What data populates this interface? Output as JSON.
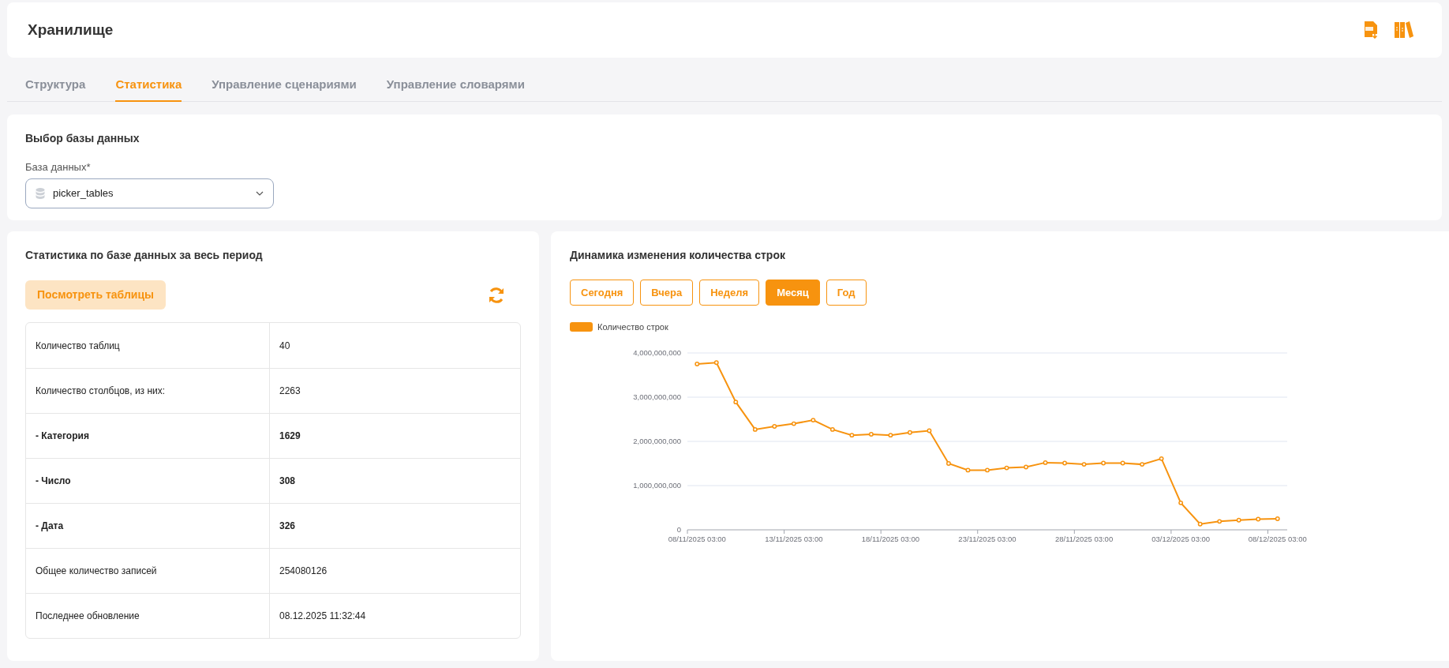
{
  "header": {
    "title": "Хранилище"
  },
  "tabs": [
    {
      "label": "Структура",
      "selected": false
    },
    {
      "label": "Статистика",
      "selected": true
    },
    {
      "label": "Управление сценариями",
      "selected": false
    },
    {
      "label": "Управление словарями",
      "selected": false
    }
  ],
  "db_select": {
    "title": "Выбор базы данных",
    "label": "База данных*",
    "value": "picker_tables"
  },
  "stats": {
    "title": "Статистика по базе данных за весь период",
    "view_button": "Посмотреть таблицы",
    "rows": [
      {
        "label": "Количество таблиц",
        "value": "40",
        "bold": false
      },
      {
        "label": "Количество столбцов, из них:",
        "value": "2263",
        "bold": false
      },
      {
        "label": "- Категория",
        "value": "1629",
        "bold": true
      },
      {
        "label": "- Число",
        "value": "308",
        "bold": true
      },
      {
        "label": "- Дата",
        "value": "326",
        "bold": true
      },
      {
        "label": "Общее количество записей",
        "value": "254080126",
        "bold": false
      },
      {
        "label": "Последнее обновление",
        "value": "08.12.2025 11:32:44",
        "bold": false
      }
    ]
  },
  "dynamics": {
    "title": "Динамика изменения количества строк",
    "periods": [
      {
        "label": "Сегодня",
        "selected": false
      },
      {
        "label": "Вчера",
        "selected": false
      },
      {
        "label": "Неделя",
        "selected": false
      },
      {
        "label": "Месяц",
        "selected": true
      },
      {
        "label": "Год",
        "selected": false
      }
    ],
    "chart_data": {
      "type": "line",
      "categories": [
        "08/11/2025 03:00",
        null,
        null,
        null,
        null,
        "13/11/2025 03:00",
        null,
        null,
        null,
        null,
        "18/11/2025 03:00",
        null,
        null,
        null,
        null,
        "23/11/2025 03:00",
        null,
        null,
        null,
        null,
        "28/11/2025 03:00",
        null,
        null,
        null,
        null,
        "03/12/2025 03:00",
        null,
        null,
        null,
        null,
        "08/12/2025 03:00"
      ],
      "grid": true,
      "ylim": [
        0,
        4000000000
      ],
      "yticks": [
        {
          "value": 0,
          "label": "0"
        },
        {
          "value": 1000000000,
          "label": "1,000,000,000"
        },
        {
          "value": 2000000000,
          "label": "2,000,000,000"
        },
        {
          "value": 3000000000,
          "label": "3,000,000,000"
        },
        {
          "value": 4000000000,
          "label": "4,000,000,000"
        }
      ],
      "series": [
        {
          "name": "Количество строк",
          "color": "#f7930f",
          "marker": true,
          "values": [
            3750000000,
            3780000000,
            2890000000,
            2270000000,
            2340000000,
            2400000000,
            2480000000,
            2270000000,
            2140000000,
            2160000000,
            2140000000,
            2200000000,
            2240000000,
            1500000000,
            1350000000,
            1350000000,
            1400000000,
            1420000000,
            1520000000,
            1510000000,
            1480000000,
            1510000000,
            1510000000,
            1480000000,
            1610000000,
            610000000,
            130000000,
            190000000,
            220000000,
            240000000,
            250000000
          ]
        }
      ]
    }
  }
}
